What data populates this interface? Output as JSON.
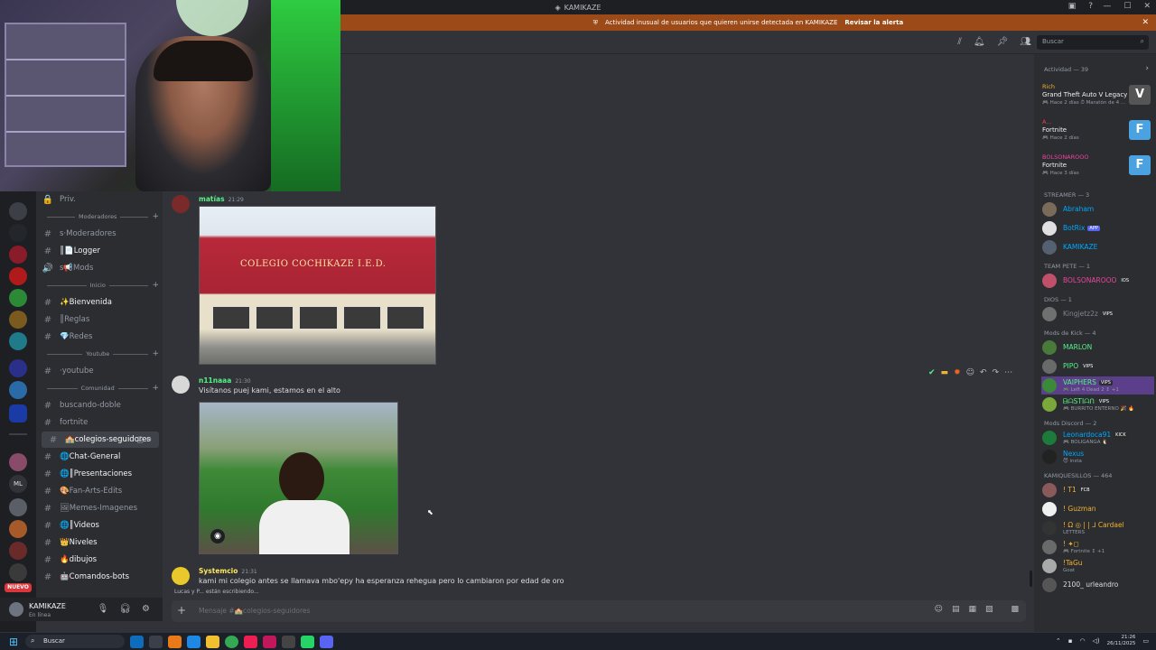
{
  "window": {
    "title": "KAMIKAZE"
  },
  "alert": {
    "text": "Actividad inusual de usuarios que quieren unirse detectada en KAMIKAZE",
    "link": "Revisar la alerta"
  },
  "header": {
    "search_placeholder": "Buscar"
  },
  "channels": {
    "items": [
      {
        "label": "Priv.",
        "prefix": "🔒"
      },
      {
        "category": "Moderadores"
      },
      {
        "label": "ꜱ·Moderadores",
        "prefix": "#"
      },
      {
        "label": "║📄Logger",
        "prefix": "#",
        "bright": true
      },
      {
        "label": "ꜱ📢Mods",
        "prefix": "🔊"
      },
      {
        "category": "Inicio"
      },
      {
        "label": "✨Bienvenida",
        "prefix": "#",
        "bright": true
      },
      {
        "label": "║Reglas",
        "prefix": "#"
      },
      {
        "label": "💎Redes",
        "prefix": "#"
      },
      {
        "category": "Youtube"
      },
      {
        "label": "·youtube",
        "prefix": "#"
      },
      {
        "category": "Comunidad"
      },
      {
        "label": "buscando-doble",
        "prefix": "#"
      },
      {
        "label": "fortnite",
        "prefix": "#"
      },
      {
        "label": "🏫colegios-seguidores",
        "prefix": "#",
        "active": true
      },
      {
        "label": "🌐Chat-General",
        "prefix": "#",
        "bright": true
      },
      {
        "label": "🌐║Presentaciones",
        "prefix": "#",
        "bright": true
      },
      {
        "label": "🎨Fan-Arts-Edits",
        "prefix": "#"
      },
      {
        "label": "🖼Memes-Imagenes",
        "prefix": "#"
      },
      {
        "label": "🌐║Videos",
        "prefix": "#",
        "bright": true
      },
      {
        "label": "👑Niveles",
        "prefix": "#",
        "bright": true
      },
      {
        "label": "🔥dibujos",
        "prefix": "#",
        "bright": true
      },
      {
        "label": "🤖Comandos-bots",
        "prefix": "#",
        "bright": true
      }
    ]
  },
  "user_panel": {
    "name": "KAMIKAZE",
    "status": "En línea"
  },
  "rail": {
    "nuevo_label": "NUEVO",
    "ml_label": "ML"
  },
  "messages": [
    {
      "author": "matías",
      "time": "21:29",
      "author_color": "#57f287",
      "image_sign": "COLEGIO COCHIKAZE I.E.D."
    },
    {
      "author": "n11naaa",
      "time": "21:30",
      "author_color": "#57f287",
      "text": "Visítanos puej kami, estamos en el alto"
    },
    {
      "author": "Systemcio",
      "time": "21:31",
      "author_color": "#fee75c",
      "text": "kami mi colegio antes se llamava mbo'epy ha esperanza rehegua pero lo cambiaron por edad de oro"
    }
  ],
  "typing": "Lucas y P... están escribiendo...",
  "composer": {
    "placeholder": "Mensaje #🏫colegios-seguidores"
  },
  "members": {
    "activity_header": "Actividad — 39",
    "activities": [
      {
        "name": "Rich",
        "game": "Grand Theft Auto V Legacy",
        "sub": "🎮 Hace 2 días  ⏱ Maratón de 4 ...",
        "name_color": "#f0b232"
      },
      {
        "name": "A...",
        "game": "Fortnite",
        "sub": "🎮 Hace 2 días",
        "name_color": "#f23f43"
      },
      {
        "name": "BOLSONAROOO",
        "game": "Fortnite",
        "sub": "🎮 Hace 3 días",
        "name_color": "#eb459e"
      }
    ],
    "groups": [
      {
        "title": "STREAMER — 3",
        "members": [
          {
            "name": "Abraham",
            "color": "#00a8fc"
          },
          {
            "name": "BotRix",
            "color": "#00a8fc",
            "badge": "APP"
          },
          {
            "name": "KAMIKAZE",
            "color": "#00a8fc"
          }
        ]
      },
      {
        "title": "TEAM PETE — 1",
        "members": [
          {
            "name": "BOLSONAROOO",
            "color": "#eb459e",
            "badge": "IOS"
          }
        ]
      },
      {
        "title": "DIOS — 1",
        "members": [
          {
            "name": "Kingjetz2z",
            "color": "#80848e",
            "badge": "VIPS"
          }
        ]
      },
      {
        "title": "Mods de Kick — 4",
        "members": [
          {
            "name": "MARLON",
            "color": "#57f287"
          },
          {
            "name": "PIPO",
            "color": "#57f287",
            "badge": "VIPS"
          },
          {
            "name": "VAIPHERS",
            "color": "#57f287",
            "badge": "VIPS",
            "sub": "🎮 Left 4 Dead 2 ↕ +1"
          },
          {
            "name": "ᗷᗩSTIᗩᑎ",
            "color": "#57f287",
            "badge": "VIPS",
            "sub": "🎮 BURRITO ENTERNO 🎉 🔥"
          }
        ]
      },
      {
        "title": "Mods Discord — 2",
        "members": [
          {
            "name": "Leonardoca91",
            "color": "#00a8fc",
            "badge": "KICK",
            "sub": "🎮 BOLIGANGA 🐧"
          },
          {
            "name": "Nexus",
            "color": "#00a8fc",
            "sub": "😈 insta"
          }
        ]
      },
      {
        "title": "KAMIQUESILLOS — 464",
        "members": [
          {
            "name": "! T1",
            "color": "#f0b232",
            "badge": "FCB"
          },
          {
            "name": "! Guzman",
            "color": "#f0b232"
          },
          {
            "name": "! Ω ◎ | | ⅃ Cardael",
            "color": "#f0b232",
            "sub": "LETTERS"
          },
          {
            "name": "! ✦◻",
            "color": "#f0b232",
            "sub": "🎮 Fortnite ↕ +1"
          },
          {
            "name": "!TaGu",
            "color": "#f0b232",
            "sub": "Goat"
          },
          {
            "name": "2100_ urleandro",
            "color": "#dbdee1"
          }
        ]
      }
    ]
  },
  "taskbar": {
    "search": "Buscar",
    "time": "21:26",
    "date": "26/11/2025"
  }
}
